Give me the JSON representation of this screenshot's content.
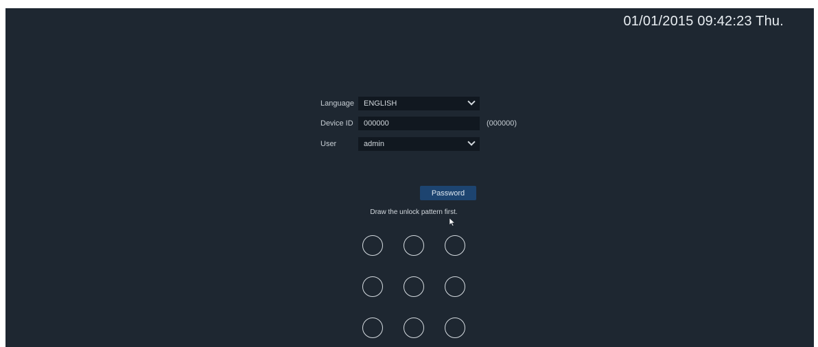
{
  "datetime": "01/01/2015 09:42:23 Thu.",
  "login": {
    "language_label": "Language",
    "language_value": "ENGLISH",
    "device_id_label": "Device ID",
    "device_id_value": "000000",
    "device_id_hint": "(000000)",
    "user_label": "User",
    "user_value": "admin",
    "password_button": "Password",
    "pattern_instruction": "Draw the unlock pattern first."
  },
  "pattern": {
    "grid_rows": 3,
    "grid_cols": 3
  },
  "colors": {
    "background": "#1e2731",
    "field": "#111820",
    "button": "#1d4470",
    "text": "#d3d9de"
  }
}
